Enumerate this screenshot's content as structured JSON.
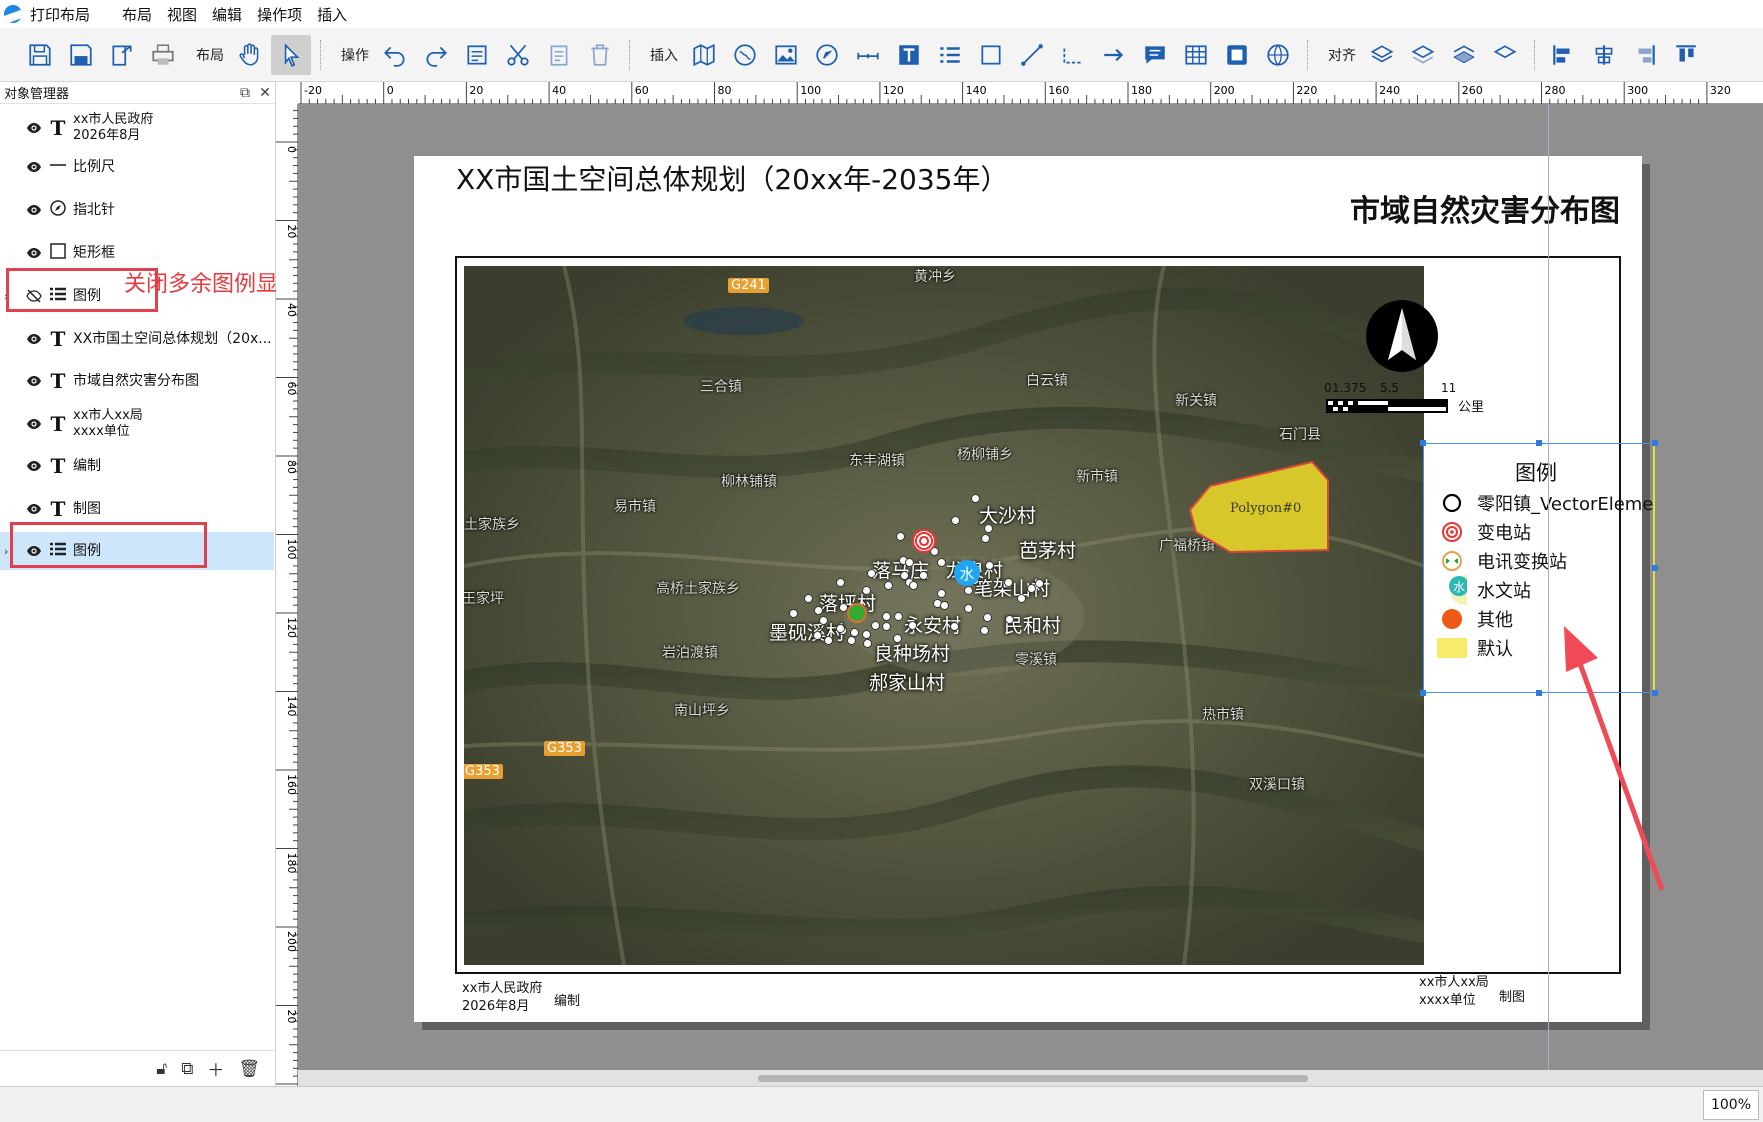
{
  "app": {
    "title": "打印布局"
  },
  "menu": [
    "布局",
    "视图",
    "编辑",
    "操作项",
    "插入"
  ],
  "toolbar": {
    "group_layout_label": "布局",
    "group_operate_label": "操作",
    "group_insert_label": "插入",
    "group_align_label": "对齐"
  },
  "panel": {
    "title": "对象管理器",
    "items": [
      {
        "line1": "xx市人民政府",
        "line2": "2026年8月",
        "icon": "text-icon",
        "visible": true
      },
      {
        "line1": "比例尺",
        "icon": "scalebar-icon",
        "visible": true
      },
      {
        "line1": "指北针",
        "icon": "compass-icon",
        "visible": true
      },
      {
        "line1": "矩形框",
        "icon": "rectangle-icon",
        "visible": true
      },
      {
        "line1": "图例",
        "icon": "legend-list-icon",
        "visible": false
      },
      {
        "line1": "XX市国土空间总体规划（20x...",
        "icon": "text-icon",
        "visible": true
      },
      {
        "line1": "市域自然灾害分布图",
        "icon": "text-icon",
        "visible": true
      },
      {
        "line1": "xx市人xx局",
        "line2": "xxxx单位",
        "icon": "text-icon",
        "visible": true
      },
      {
        "line1": "编制",
        "icon": "text-icon",
        "visible": true
      },
      {
        "line1": "制图",
        "icon": "text-icon",
        "visible": true
      },
      {
        "line1": "图例",
        "icon": "legend-list-icon",
        "visible": true,
        "selected": true
      }
    ]
  },
  "annotation": {
    "text": "关闭多余图例显示",
    "color": "#e8393f"
  },
  "ruler": {
    "h": [
      "-20",
      "0",
      "20",
      "40",
      "60",
      "80",
      "100",
      "120",
      "140",
      "160",
      "180",
      "200",
      "220",
      "240",
      "260",
      "280",
      "300",
      "320"
    ],
    "v": [
      "0",
      "20",
      "40",
      "60",
      "80",
      "100",
      "120",
      "140",
      "160",
      "180",
      "200",
      "20"
    ]
  },
  "page": {
    "main_title": "XX市国土空间总体规划（20xx年-2035年）",
    "map_title": "市域自然灾害分布图",
    "footer_left_line1": "xx市人民政府",
    "footer_left_line2": "2026年8月",
    "footer_left_tag": "编制",
    "footer_right_line1": "xx市人xx局",
    "footer_right_line2": "xxxx单位",
    "footer_right_tag": "制图"
  },
  "scalebar": {
    "ticks": [
      "0",
      "1.375",
      "5.5",
      "11"
    ],
    "unit": "公里"
  },
  "legend": {
    "title": "图例",
    "items": [
      {
        "label": "零阳镇_VectorEleme",
        "symbol": "circle-outline"
      },
      {
        "label": "变电站",
        "symbol": "target"
      },
      {
        "label": "电讯变换站",
        "symbol": "telecom"
      },
      {
        "label": "水文站",
        "symbol": "hydro"
      },
      {
        "label": "其他",
        "symbol": "orange-dot"
      },
      {
        "label": "默认",
        "symbol": "yellow-rect"
      }
    ]
  },
  "map": {
    "road_badges": [
      "G241",
      "G353",
      "G353"
    ],
    "places": [
      "三合镇",
      "白云镇",
      "新关镇",
      "石门县",
      "东丰湖镇",
      "杨柳铺乡",
      "柳林铺镇",
      "易市镇",
      "新市镇",
      "广福桥镇",
      "高桥土家族乡",
      "岩泊渡镇",
      "南山坪乡",
      "零溪镇",
      "热市镇",
      "双溪口镇",
      "土家族乡",
      "王家坪",
      "黄冲乡"
    ],
    "villages": [
      "大沙村",
      "芭茅村",
      "落马庄",
      "龙泉村",
      "笔架山村",
      "落坪村",
      "永安村",
      "民和村",
      "墨砚溪村",
      "良种场村",
      "郝家山村"
    ],
    "hydro_glyph": "水",
    "polygon_label": "Polygon#0"
  },
  "statusbar": {
    "zoom": "100%"
  },
  "colors": {
    "accent": "#1f5fb0",
    "highlight": "#e0414d",
    "selected_row": "#cde6fb",
    "polygon": "#d8c72a"
  }
}
